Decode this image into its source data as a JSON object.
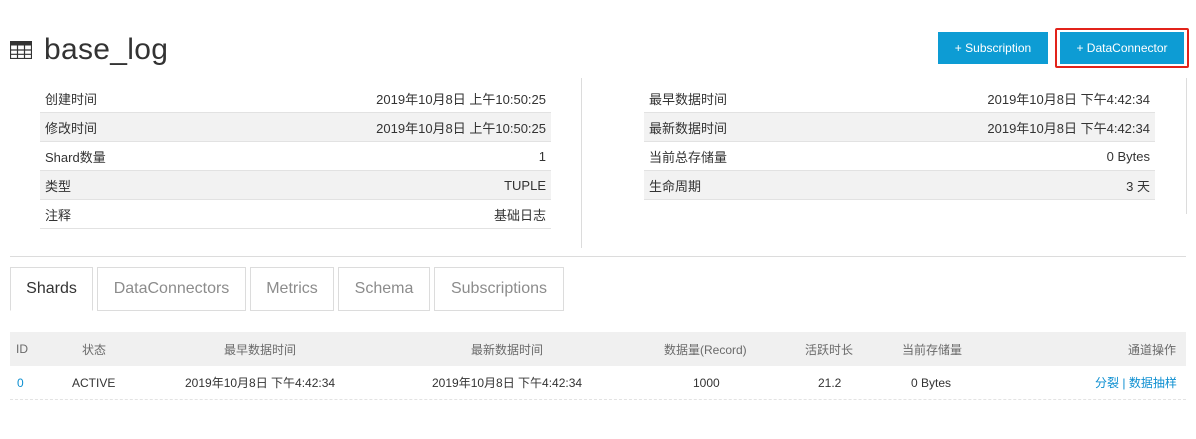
{
  "header": {
    "title": "base_log",
    "subscription_button": "+ Subscription",
    "dataconnector_button": "+ DataConnector"
  },
  "info_left": [
    {
      "label": "创建时间",
      "value": "2019年10月8日 上午10:50:25"
    },
    {
      "label": "修改时间",
      "value": "2019年10月8日 上午10:50:25"
    },
    {
      "label": "Shard数量",
      "value": "1"
    },
    {
      "label": "类型",
      "value": "TUPLE"
    },
    {
      "label": "注释",
      "value": "基础日志"
    }
  ],
  "info_right": [
    {
      "label": "最早数据时间",
      "value": "2019年10月8日 下午4:42:34"
    },
    {
      "label": "最新数据时间",
      "value": "2019年10月8日 下午4:42:34"
    },
    {
      "label": "当前总存储量",
      "value": "0 Bytes"
    },
    {
      "label": "生命周期",
      "value": "3 天"
    }
  ],
  "tabs": [
    {
      "label": "Shards",
      "active": true
    },
    {
      "label": "DataConnectors",
      "active": false
    },
    {
      "label": "Metrics",
      "active": false
    },
    {
      "label": "Schema",
      "active": false
    },
    {
      "label": "Subscriptions",
      "active": false
    }
  ],
  "shards_table": {
    "columns": [
      "ID",
      "状态",
      "最早数据时间",
      "最新数据时间",
      "数据量(Record)",
      "活跃时长",
      "当前存储量",
      "通道操作"
    ],
    "rows": [
      {
        "id": "0",
        "status": "ACTIVE",
        "first_time": "2019年10月8日 下午4:42:34",
        "last_time": "2019年10月8日 下午4:42:34",
        "records": "1000",
        "active_duration": "21.2",
        "storage": "0 Bytes",
        "op_split": "分裂",
        "op_sep": " | ",
        "op_sample": "数据抽样"
      }
    ]
  },
  "colors": {
    "primary_button": "#0d9cd4",
    "highlight_border": "#e2231a",
    "link": "#0d8fd1"
  }
}
